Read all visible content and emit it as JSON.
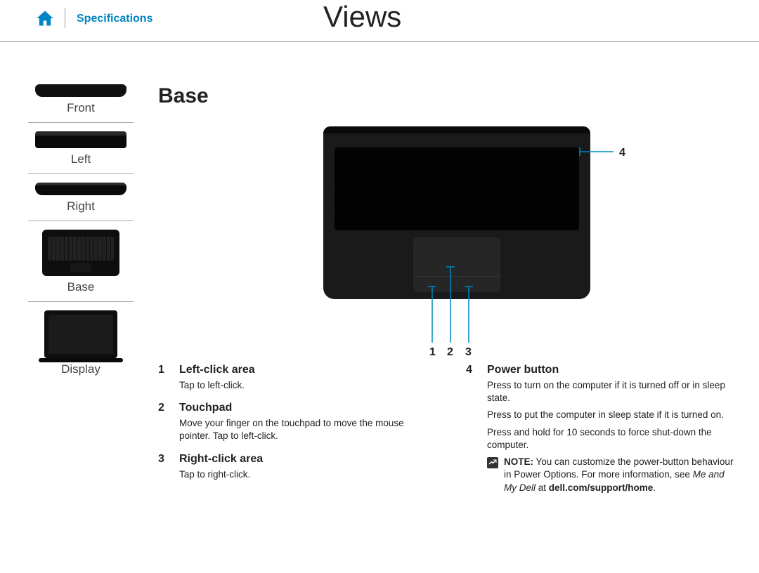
{
  "header": {
    "spec_link_label": "Specifications",
    "page_title": "Views"
  },
  "sidebar": {
    "items": [
      {
        "label": "Front"
      },
      {
        "label": "Left"
      },
      {
        "label": "Right"
      },
      {
        "label": "Base"
      },
      {
        "label": "Display"
      }
    ]
  },
  "main": {
    "section_title": "Base",
    "callouts": [
      "1",
      "2",
      "3",
      "4"
    ],
    "left_column": [
      {
        "num": "1",
        "title": "Left-click area",
        "body": [
          "Tap to left-click."
        ]
      },
      {
        "num": "2",
        "title": "Touchpad",
        "body": [
          "Move your finger on the touchpad to move the mouse pointer. Tap to left-click."
        ]
      },
      {
        "num": "3",
        "title": "Right-click area",
        "body": [
          "Tap to right-click."
        ]
      }
    ],
    "right_column": [
      {
        "num": "4",
        "title": "Power button",
        "body": [
          "Press to turn on the computer if it is turned off or in sleep state.",
          "Press to put the computer in sleep state if it is turned on.",
          "Press and hold for 10 seconds to force shut-down the computer."
        ],
        "note": {
          "label": "NOTE:",
          "text_before_italic": " You can customize the power-button behaviour in Power Options. For more information, see ",
          "italic": "Me and My Dell",
          "text_after_italic": " at ",
          "bold_link": "dell.com/support/home",
          "period": "."
        }
      }
    ]
  }
}
